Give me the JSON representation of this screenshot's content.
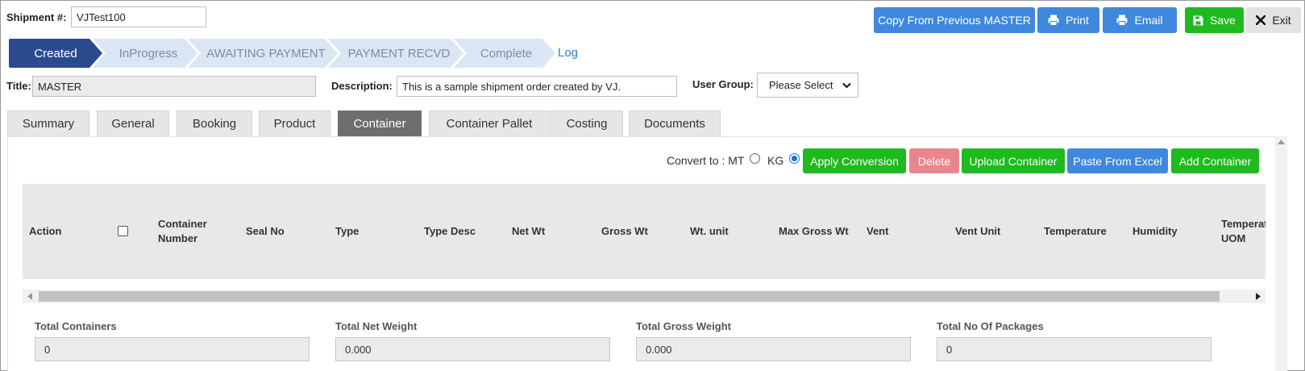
{
  "header": {
    "shipment_label": "Shipment #:",
    "shipment_value": "VJTest100",
    "title_label": "Title:",
    "title_value": "MASTER",
    "description_label": "Description:",
    "description_value": "This is a sample shipment order created by VJ.",
    "user_group_label": "User Group:",
    "user_group_value": "Please Select"
  },
  "toolbar": {
    "copy_label": "Copy From Previous MASTER",
    "print_label": "Print",
    "email_label": "Email",
    "save_label": "Save",
    "exit_label": "Exit"
  },
  "steps": [
    "Created",
    "InProgress",
    "AWAITING PAYMENT",
    "PAYMENT RECVD",
    "Complete"
  ],
  "active_step": "Created",
  "log_label": "Log",
  "tabs": [
    "Summary",
    "General",
    "Booking",
    "Product",
    "Container",
    "Container Pallet",
    "Costing",
    "Documents"
  ],
  "active_tab": "Container",
  "container": {
    "convert_label": "Convert to : MT",
    "kg_label": "KG",
    "selected_unit": "KG",
    "apply_label": "Apply Conversion",
    "delete_label": "Delete",
    "upload_label": "Upload Container",
    "paste_label": "Paste From Excel",
    "add_label": "Add Container",
    "columns": [
      "Action",
      "",
      "Container Number",
      "Seal No",
      "Type",
      "Type Desc",
      "Net Wt",
      "Gross Wt",
      "Wt. unit",
      "Max Gross Wt",
      "Vent",
      "Vent Unit",
      "Temperature",
      "Humidity",
      "Temperature UOM"
    ]
  },
  "totals": [
    {
      "label": "Total Containers",
      "value": "0"
    },
    {
      "label": "Total Net Weight",
      "value": "0.000"
    },
    {
      "label": "Total Gross Weight",
      "value": "0.000"
    },
    {
      "label": "Total No Of Packages",
      "value": "0"
    }
  ],
  "colors": {
    "blue": "#3f88dd",
    "green": "#1fba1f",
    "pink": "#e9868d",
    "step_active": "#2b4a8e",
    "step_inactive": "#dbe6f5"
  }
}
